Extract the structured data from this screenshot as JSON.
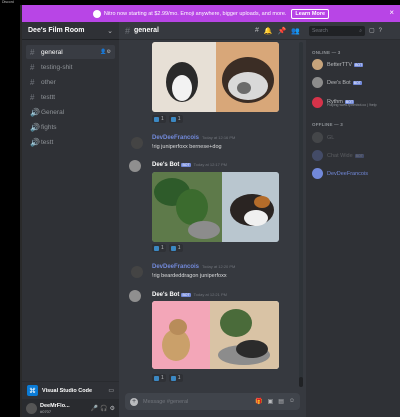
{
  "window": {
    "title": "Discord"
  },
  "nitro_banner": {
    "text": "Nitro now starting at $2.99/mo. Emoji anywhere, bigger uploads, and more.",
    "button": "Learn More",
    "close": "×"
  },
  "server": {
    "name": "Dee's Film Room",
    "chevron": "⌄"
  },
  "channels": [
    {
      "name": "general",
      "type": "text",
      "active": true
    },
    {
      "name": "testing-shit",
      "type": "text",
      "active": false
    },
    {
      "name": "other",
      "type": "text",
      "active": false
    },
    {
      "name": "testtt",
      "type": "text",
      "active": false
    },
    {
      "name": "General",
      "type": "voice",
      "active": false
    },
    {
      "name": "fights",
      "type": "voice",
      "active": false
    },
    {
      "name": "testt",
      "type": "voice",
      "active": false
    }
  ],
  "activity": {
    "label": "Visual Studio Code"
  },
  "user_panel": {
    "username": "DeeMrFlo...",
    "discriminator": "#0707"
  },
  "chat": {
    "channel": "general",
    "messages": [
      {
        "author": "DevDeeFrancois",
        "time": "Today at 12:16 PM",
        "text": "!rig juniperfoxx bernese+dog",
        "bot": false
      },
      {
        "author": "Dee's Bot",
        "time": "Today at 12:17 PM",
        "text": "",
        "bot": true
      },
      {
        "author": "DevDeeFrancois",
        "time": "Today at 12:20 PM",
        "text": "!rig beardeddragon juniperfoxx",
        "bot": false
      },
      {
        "author": "Dee's Bot",
        "time": "Today at 12:21 PM",
        "text": "",
        "bot": true
      }
    ],
    "reaction_count": "1",
    "bot_badge": "BOT",
    "composer_placeholder": "Message #general"
  },
  "search": {
    "placeholder": "Search"
  },
  "members": {
    "online_label": "ONLINE — 3",
    "offline_label": "OFFLINE — 3",
    "online": [
      {
        "name": "BetterTTV",
        "bot": true,
        "color": "#c7a47c",
        "status": ""
      },
      {
        "name": "Dee's Bot",
        "bot": true,
        "color": "#8c8c8c",
        "status": ""
      },
      {
        "name": "Rythm",
        "bot": true,
        "color": "#d6334a",
        "status": "Playing www.rythmbot.co | !help"
      }
    ],
    "offline": [
      {
        "name": "GL",
        "bot": false,
        "color": "#777777"
      },
      {
        "name": "Chat Wide",
        "bot": true,
        "color": "#7289da"
      },
      {
        "name": "DevDeeFrancois",
        "bot": false,
        "color": "#7289da"
      }
    ]
  },
  "colors": {
    "nitro": "#b845e6",
    "blurple": "#7289da",
    "sidebar": "#2f3136",
    "chat": "#36393f"
  }
}
